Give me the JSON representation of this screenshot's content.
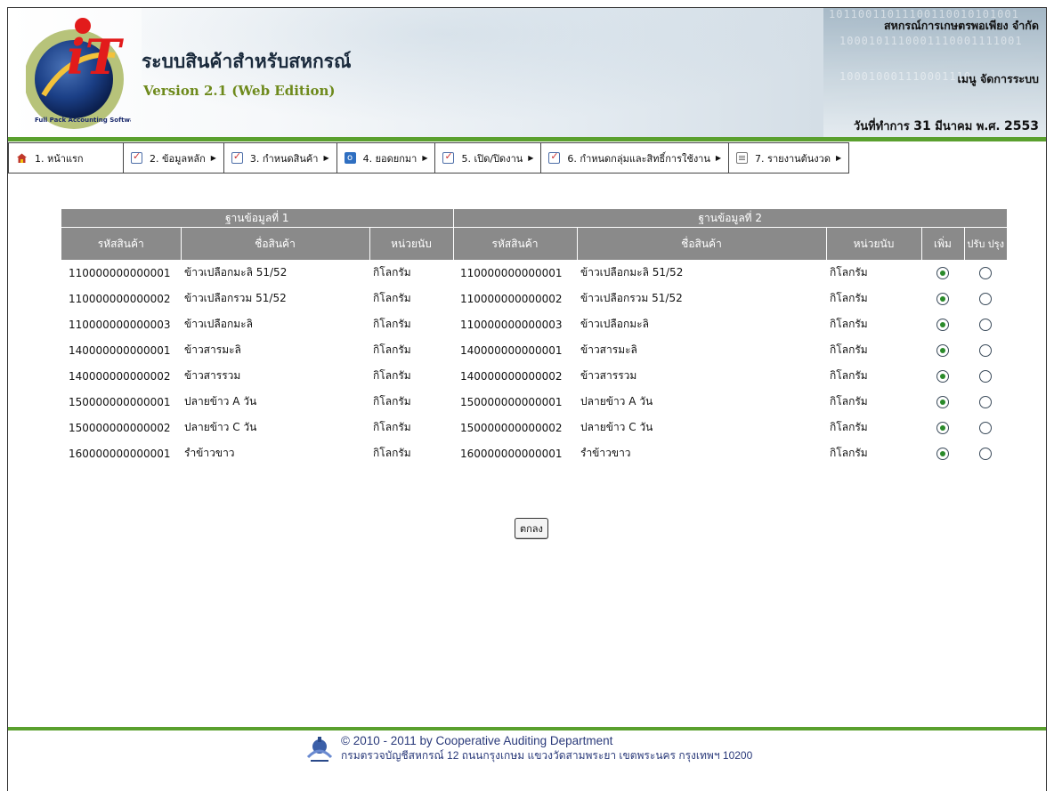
{
  "header": {
    "logo_text": "iT",
    "logo_ring_text": "Full Pack Accounting Software : FAS",
    "app_title": "ระบบสินค้าสำหรับสหกรณ์",
    "version": "Version 2.1 (Web Edition)",
    "coop_name": "สหกรณ์การเกษตรพอเพียง จำกัด",
    "admin_menu": "เมนู จัดการระบบ",
    "work_date_prefix": "วันที่ทำการ",
    "work_date_day": "31",
    "work_date_month": "มีนาคม พ.ศ.",
    "work_date_year": "2553",
    "binary_lines": [
      "10110011011100110010101001",
      "1000101110001110001111001",
      "100010001110001110"
    ]
  },
  "menu": [
    {
      "label": "1. หน้าแรก",
      "icon": "home-icon",
      "submenu": false
    },
    {
      "label": "2. ข้อมูลหลัก",
      "icon": "checklist-icon",
      "submenu": true
    },
    {
      "label": "3. กำหนดสินค้า",
      "icon": "checklist-icon",
      "submenu": true
    },
    {
      "label": "4. ยอดยกมา",
      "icon": "info-icon",
      "submenu": true
    },
    {
      "label": "5. เปิด/ปิดงาน",
      "icon": "checklist-icon",
      "submenu": true
    },
    {
      "label": "6. กำหนดกลุ่มและสิทธิ์การใช้งาน",
      "icon": "checklist-icon",
      "submenu": true
    },
    {
      "label": "7. รายงานต้นงวด",
      "icon": "document-icon",
      "submenu": true
    }
  ],
  "table": {
    "group1": "ฐานข้อมูลที่ 1",
    "group2": "ฐานข้อมูลที่ 2",
    "columns": {
      "code1": "รหัสสินค้า",
      "name1": "ชื่อสินค้า",
      "unit1": "หน่วยนับ",
      "code2": "รหัสสินค้า",
      "name2": "ชื่อสินค้า",
      "unit2": "หน่วยนับ",
      "add": "เพิ่ม",
      "update": "ปรับ ปรุง"
    },
    "rows": [
      {
        "code1": "110000000000001",
        "name1": "ข้าวเปลือกมะลิ 51/52",
        "unit1": "กิโลกรัม",
        "code2": "110000000000001",
        "name2": "ข้าวเปลือกมะลิ 51/52",
        "unit2": "กิโลกรัม",
        "choice": "add"
      },
      {
        "code1": "110000000000002",
        "name1": "ข้าวเปลือกรวม 51/52",
        "unit1": "กิโลกรัม",
        "code2": "110000000000002",
        "name2": "ข้าวเปลือกรวม 51/52",
        "unit2": "กิโลกรัม",
        "choice": "add"
      },
      {
        "code1": "110000000000003",
        "name1": "ข้าวเปลือกมะลิ",
        "unit1": "กิโลกรัม",
        "code2": "110000000000003",
        "name2": "ข้าวเปลือกมะลิ",
        "unit2": "กิโลกรัม",
        "choice": "add"
      },
      {
        "code1": "140000000000001",
        "name1": "ข้าวสารมะลิ",
        "unit1": "กิโลกรัม",
        "code2": "140000000000001",
        "name2": "ข้าวสารมะลิ",
        "unit2": "กิโลกรัม",
        "choice": "add"
      },
      {
        "code1": "140000000000002",
        "name1": "ข้าวสารรวม",
        "unit1": "กิโลกรัม",
        "code2": "140000000000002",
        "name2": "ข้าวสารรวม",
        "unit2": "กิโลกรัม",
        "choice": "add"
      },
      {
        "code1": "150000000000001",
        "name1": "ปลายข้าว A วัน",
        "unit1": "กิโลกรัม",
        "code2": "150000000000001",
        "name2": "ปลายข้าว A วัน",
        "unit2": "กิโลกรัม",
        "choice": "add"
      },
      {
        "code1": "150000000000002",
        "name1": "ปลายข้าว C วัน",
        "unit1": "กิโลกรัม",
        "code2": "150000000000002",
        "name2": "ปลายข้าว C วัน",
        "unit2": "กิโลกรัม",
        "choice": "add"
      },
      {
        "code1": "160000000000001",
        "name1": "รำข้าวขาว",
        "unit1": "กิโลกรัม",
        "code2": "160000000000001",
        "name2": "รำข้าวขาว",
        "unit2": "กิโลกรัม",
        "choice": "add"
      }
    ]
  },
  "ok_button": "ตกลง",
  "footer": {
    "copyright": "© 2010 - 2011  by Cooperative Auditing Department",
    "address": "กรมตรวจบัญชีสหกรณ์ 12 ถนนกรุงเกษม แขวงวัดสามพระยา เขตพระนคร กรุงเทพฯ 10200"
  },
  "colors": {
    "accent_green": "#5aa02e",
    "table_header": "#8a8a8a",
    "version_text": "#6e8a1c"
  }
}
